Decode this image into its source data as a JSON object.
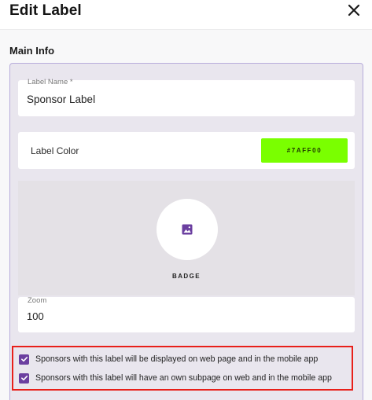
{
  "dialog": {
    "title": "Edit Label"
  },
  "main_info": {
    "section_title": "Main Info",
    "label_name": {
      "label": "Label Name *",
      "value": "Sponsor Label"
    },
    "label_color": {
      "label": "Label Color",
      "value": "#7AFF00",
      "swatch_color": "#7AFF00"
    },
    "badge": {
      "label": "BADGE",
      "icon": "image-icon"
    },
    "zoom": {
      "label": "Zoom",
      "value": "100"
    },
    "options": [
      {
        "label": "Sponsors with this label will be displayed on web page and in the mobile app",
        "checked": true
      },
      {
        "label": "Sponsors with this label will have an own subpage on web and in the mobile app",
        "checked": true
      }
    ]
  },
  "colors": {
    "accent": "#6B3FA0",
    "highlight_border": "#E8201A",
    "panel_border": "#B8ADDB"
  }
}
